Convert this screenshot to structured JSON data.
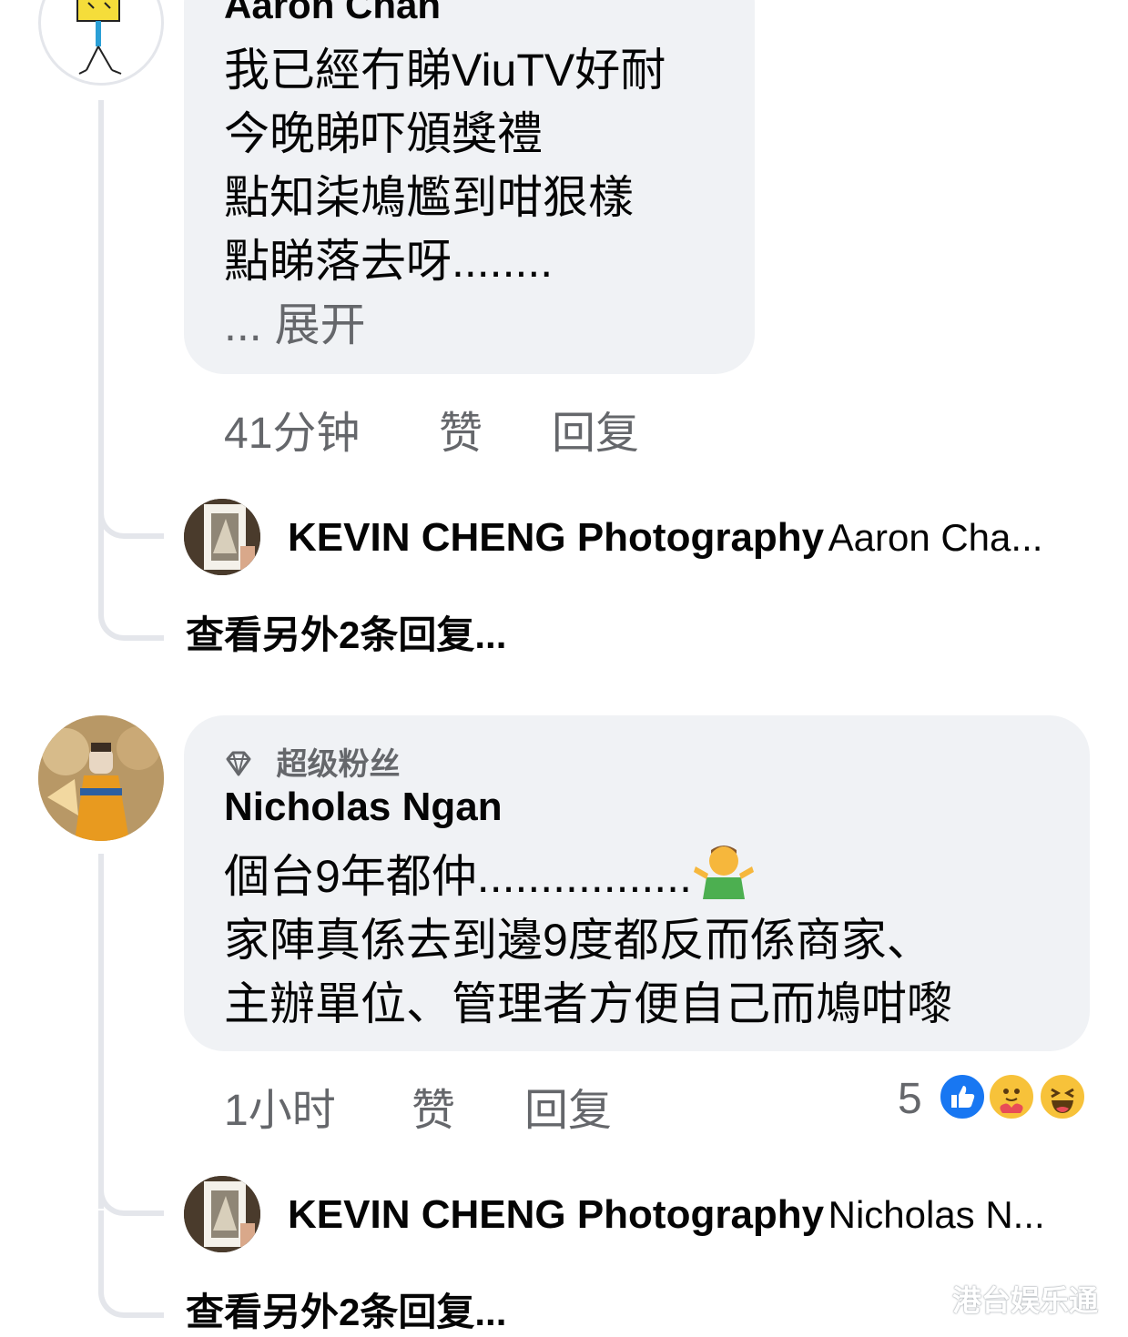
{
  "comments": [
    {
      "author": "Aaron Chan",
      "lines": [
        "我已經冇睇ViuTV好耐",
        "今晚睇吓頒獎禮",
        "點知柒鳩尷到咁狠樣",
        "點睇落去呀........"
      ],
      "see_more": "... 展开",
      "time": "41分钟",
      "like_label": "赞",
      "reply_label": "回复",
      "reply_preview": {
        "author": "KEVIN CHENG Photography",
        "text": "Aaron Cha..."
      },
      "view_more": "查看另外2条回复..."
    },
    {
      "badge": "超级粉丝",
      "author": "Nicholas Ngan",
      "lines": [
        "個台9年都仲.................",
        "家陣真係去到邊9度都反而係商家、",
        "主辦單位、管理者方便自己而鳩咁嚟"
      ],
      "time": "1小时",
      "like_label": "赞",
      "reply_label": "回复",
      "reaction_count": "5",
      "reaction_icons": [
        "like-icon",
        "care-icon",
        "haha-icon"
      ],
      "reply_preview": {
        "author": "KEVIN CHENG Photography",
        "text": "Nicholas N..."
      },
      "view_more": "查看另外2条回复..."
    }
  ],
  "watermark": "港台娱乐通",
  "colors": {
    "bubble": "#f0f2f5",
    "meta": "#65676b",
    "like_blue": "#1877f2",
    "line": "#e4e6eb"
  }
}
